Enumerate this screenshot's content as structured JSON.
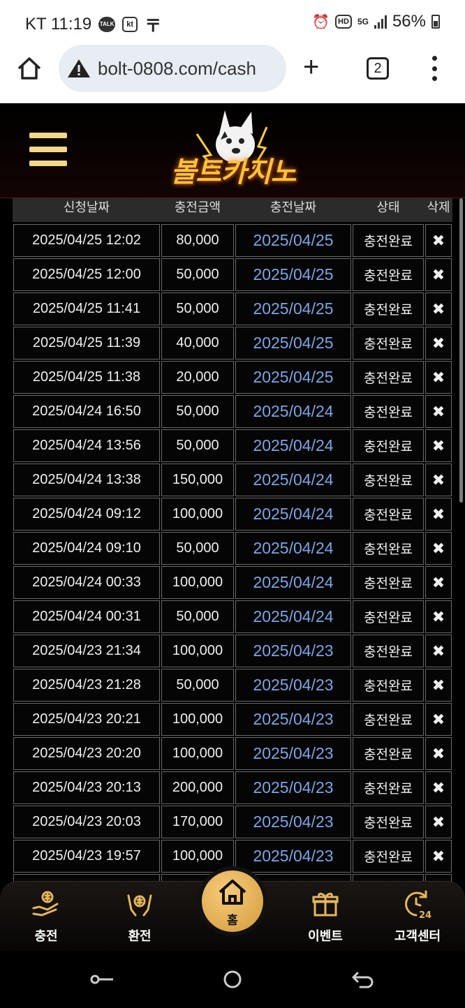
{
  "status_bar": {
    "carrier": "KT",
    "time": "11:19",
    "talk_badge": "TALK",
    "kt_badge": "kt",
    "hd_badge": "HD",
    "net_badge": "5G",
    "battery": "56%"
  },
  "browser": {
    "url": "bolt-0808.com/cash",
    "tab_count": "2"
  },
  "header": {
    "logo_text": "볼트카지노"
  },
  "table": {
    "headers": [
      "신청날짜",
      "충전금액",
      "충전날짜",
      "상태",
      "삭제"
    ],
    "rows": [
      {
        "requested": "2025/04/25 12:02",
        "amount": "80,000",
        "charged": "2025/04/25",
        "status": "충전완료"
      },
      {
        "requested": "2025/04/25 12:00",
        "amount": "50,000",
        "charged": "2025/04/25",
        "status": "충전완료"
      },
      {
        "requested": "2025/04/25 11:41",
        "amount": "50,000",
        "charged": "2025/04/25",
        "status": "충전완료"
      },
      {
        "requested": "2025/04/25 11:39",
        "amount": "40,000",
        "charged": "2025/04/25",
        "status": "충전완료"
      },
      {
        "requested": "2025/04/25 11:38",
        "amount": "20,000",
        "charged": "2025/04/25",
        "status": "충전완료"
      },
      {
        "requested": "2025/04/24 16:50",
        "amount": "50,000",
        "charged": "2025/04/24",
        "status": "충전완료"
      },
      {
        "requested": "2025/04/24 13:56",
        "amount": "50,000",
        "charged": "2025/04/24",
        "status": "충전완료"
      },
      {
        "requested": "2025/04/24 13:38",
        "amount": "150,000",
        "charged": "2025/04/24",
        "status": "충전완료"
      },
      {
        "requested": "2025/04/24 09:12",
        "amount": "100,000",
        "charged": "2025/04/24",
        "status": "충전완료"
      },
      {
        "requested": "2025/04/24 09:10",
        "amount": "50,000",
        "charged": "2025/04/24",
        "status": "충전완료"
      },
      {
        "requested": "2025/04/24 00:33",
        "amount": "100,000",
        "charged": "2025/04/24",
        "status": "충전완료"
      },
      {
        "requested": "2025/04/24 00:31",
        "amount": "50,000",
        "charged": "2025/04/24",
        "status": "충전완료"
      },
      {
        "requested": "2025/04/23 21:34",
        "amount": "100,000",
        "charged": "2025/04/23",
        "status": "충전완료"
      },
      {
        "requested": "2025/04/23 21:28",
        "amount": "50,000",
        "charged": "2025/04/23",
        "status": "충전완료"
      },
      {
        "requested": "2025/04/23 20:21",
        "amount": "100,000",
        "charged": "2025/04/23",
        "status": "충전완료"
      },
      {
        "requested": "2025/04/23 20:20",
        "amount": "100,000",
        "charged": "2025/04/23",
        "status": "충전완료"
      },
      {
        "requested": "2025/04/23 20:13",
        "amount": "200,000",
        "charged": "2025/04/23",
        "status": "충전완료"
      },
      {
        "requested": "2025/04/23 20:03",
        "amount": "170,000",
        "charged": "2025/04/23",
        "status": "충전완료"
      },
      {
        "requested": "2025/04/23 19:57",
        "amount": "100,000",
        "charged": "2025/04/23",
        "status": "충전완료"
      }
    ],
    "delete_glyph": "✖"
  },
  "bottom_nav": {
    "deposit": "충전",
    "withdraw": "환전",
    "home": "홈",
    "event": "이벤트",
    "support": "고객센터"
  },
  "theme": {
    "accent_gold": "#f3d88a",
    "date_blue": "#7aa6e6"
  }
}
